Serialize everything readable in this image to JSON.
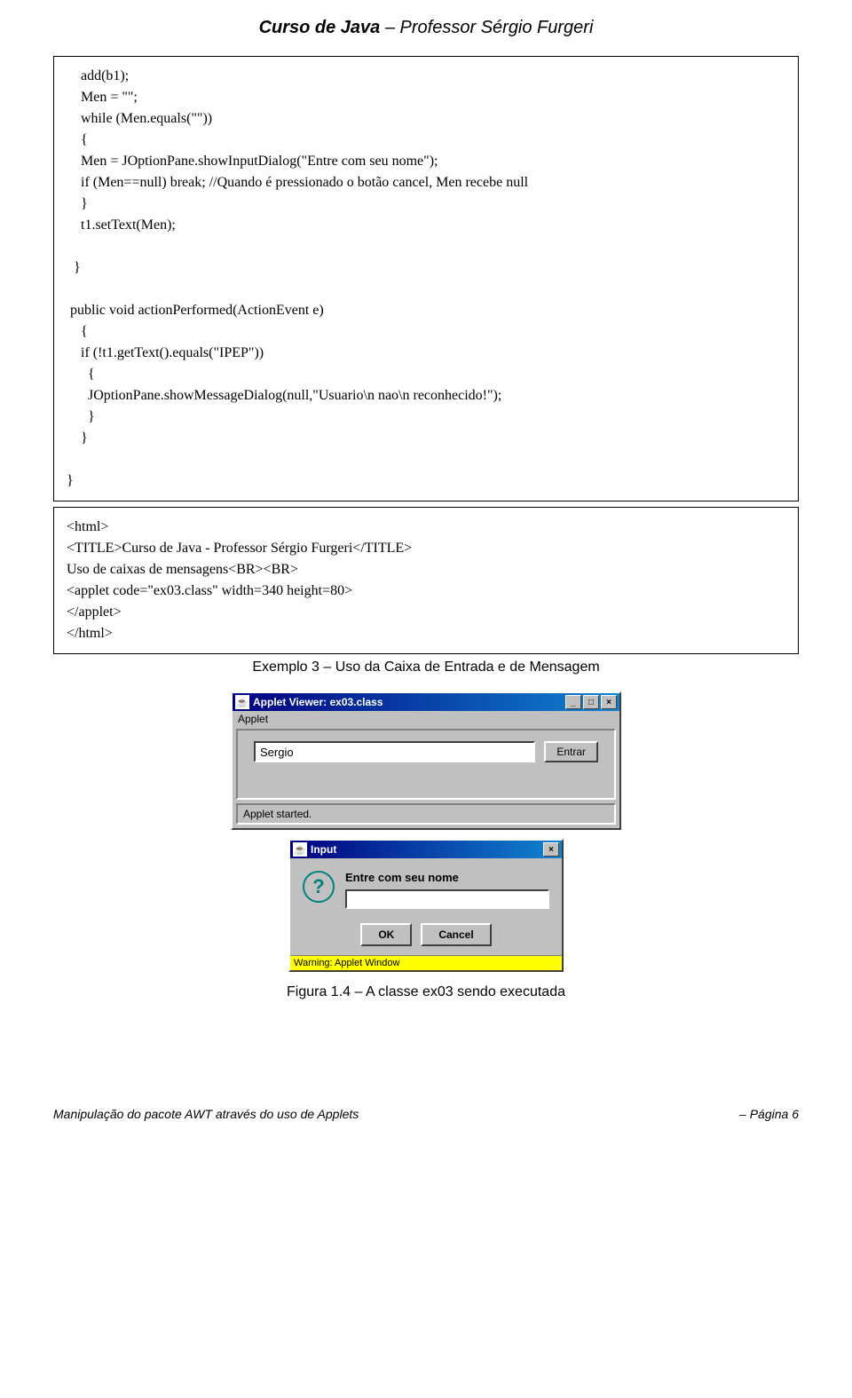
{
  "header": {
    "course": "Curso de Java",
    "dash": "  –  ",
    "professor": "Professor Sérgio Furgeri"
  },
  "code1": "    add(b1);\n    Men = \"\";\n    while (Men.equals(\"\"))\n    {\n    Men = JOptionPane.showInputDialog(\"Entre com seu nome\");\n    if (Men==null) break; //Quando é pressionado o botão cancel, Men recebe null\n    }\n    t1.setText(Men);\n\n  }\n\n public void actionPerformed(ActionEvent e)\n    {\n    if (!t1.getText().equals(\"IPEP\"))\n      {\n      JOptionPane.showMessageDialog(null,\"Usuario\\n nao\\n reconhecido!\");\n      }\n    }\n\n}",
  "code2": "<html>\n<TITLE>Curso de Java - Professor Sérgio Furgeri</TITLE>\nUso de caixas de mensagens<BR><BR>\n<applet code=\"ex03.class\" width=340 height=80>\n</applet>\n</html>",
  "caption1": "Exemplo 3 – Uso da Caixa de Entrada e de Mensagem",
  "appletViewer": {
    "title": "Applet Viewer: ex03.class",
    "menu": "Applet",
    "inputValue": "Sergio",
    "buttonLabel": "Entrar",
    "status": "Applet started."
  },
  "inputDialog": {
    "title": "Input",
    "prompt": "Entre com seu nome",
    "ok": "OK",
    "cancel": "Cancel",
    "warning": "Warning: Applet Window"
  },
  "figureCaption": "Figura 1.4 – A classe ex03 sendo executada",
  "footer": {
    "left": "Manipulação do pacote AWT através do uso de Applets",
    "right": "– Página 6"
  },
  "icons": {
    "minimize": "_",
    "maximize": "□",
    "close": "×",
    "question": "?",
    "javaCup": "☕"
  }
}
